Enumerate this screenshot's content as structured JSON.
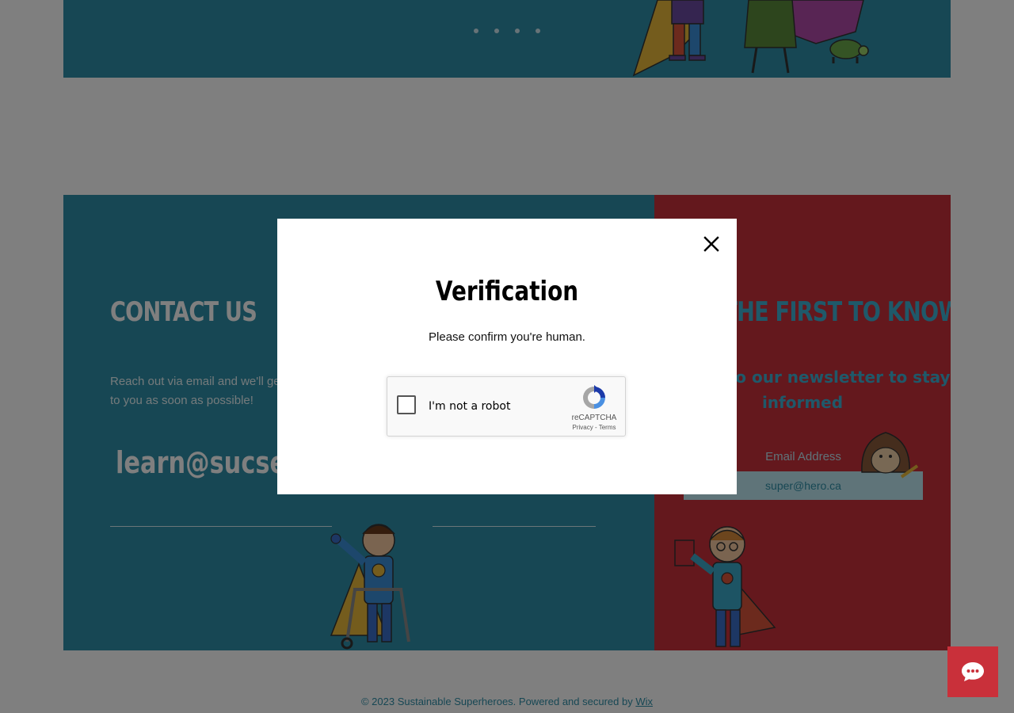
{
  "hero": {
    "slider_dots": 4
  },
  "contact": {
    "title": "CONTACT US",
    "text": "Reach out via email and we'll get back to you as soon as possible!",
    "email": "learn@sucseed.ca"
  },
  "newsletter": {
    "title": "BE THE FIRST TO KNOW",
    "subtitle": "Sign up to our newsletter to stay informed",
    "email_label": "Email Address",
    "email_placeholder": "super@hero.ca"
  },
  "footer": {
    "text": "© 2023 Sustainable Superheroes. Powered and secured by ",
    "link": "Wix"
  },
  "modal": {
    "title": "Verification",
    "text": "Please confirm you're human.",
    "recaptcha": {
      "label": "I'm not a robot",
      "brand": "reCAPTCHA",
      "privacy": "Privacy",
      "separator": " - ",
      "terms": "Terms"
    }
  },
  "colors": {
    "teal": "#2e8fa8",
    "red": "#c9303a",
    "light_blue": "#3fb2d4"
  },
  "icons": {
    "close": "close-icon",
    "chat": "chat-bubble-icon",
    "recaptcha": "recaptcha-logo-icon"
  }
}
